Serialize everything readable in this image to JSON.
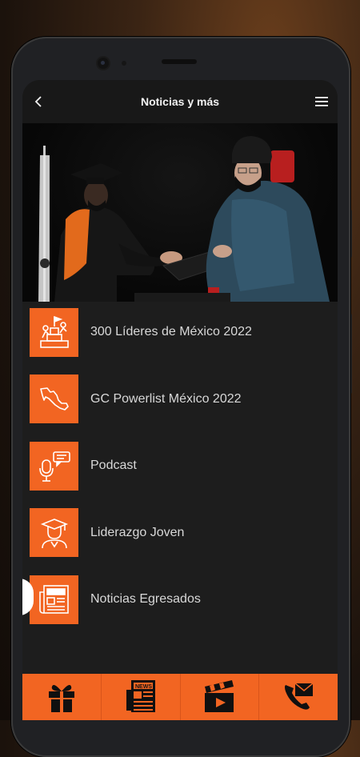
{
  "appbar": {
    "title": "Noticias y más",
    "back_icon": "chevron-left-icon",
    "menu_icon": "hamburger-menu-icon"
  },
  "hero": {
    "description_icon": "graduation-ceremony-photo"
  },
  "menu_items": [
    {
      "label": "300 Líderes de México 2022",
      "icon": "leaders-podium-icon"
    },
    {
      "label": "GC Powerlist México 2022",
      "icon": "mexico-map-icon"
    },
    {
      "label": "Podcast",
      "icon": "podcast-microphone-icon"
    },
    {
      "label": "Liderazgo Joven",
      "icon": "graduate-icon"
    },
    {
      "label": "Noticias Egresados",
      "icon": "newspaper-icon"
    }
  ],
  "bottom_nav": [
    {
      "name": "gift-icon"
    },
    {
      "name": "news-icon"
    },
    {
      "name": "clapperboard-icon"
    },
    {
      "name": "phone-mail-icon"
    }
  ],
  "colors": {
    "accent": "#f26522",
    "screen_bg": "#1d1d1d",
    "appbar_bg": "#181818",
    "text": "#d8d8d8"
  }
}
